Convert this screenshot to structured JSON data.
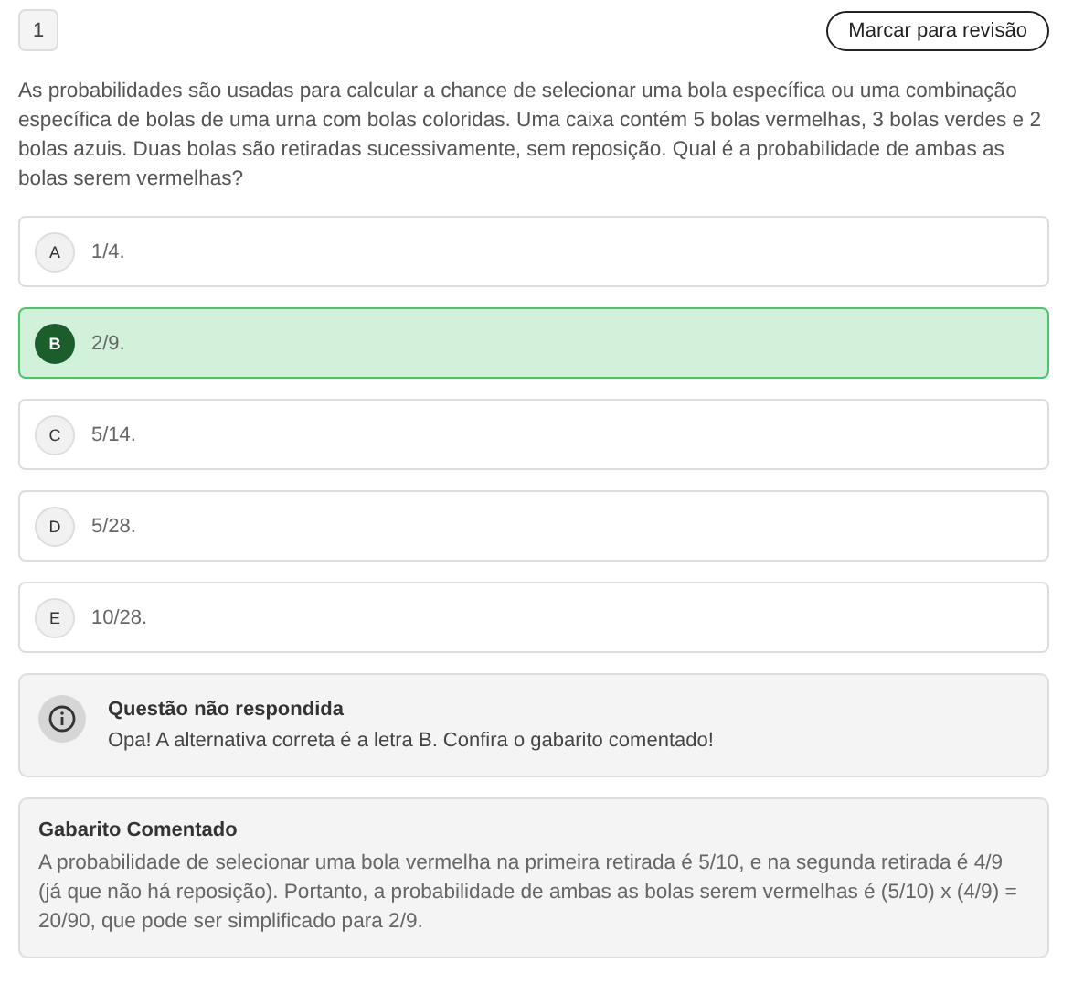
{
  "question_number": "1",
  "review_button": "Marcar para revisão",
  "question": "As probabilidades são usadas para calcular a chance de selecionar uma bola específica ou uma combinação específica de bolas de uma urna com bolas coloridas. Uma caixa contém 5 bolas vermelhas, 3 bolas verdes e 2 bolas azuis. Duas bolas são retiradas sucessivamente, sem reposição. Qual é a probabilidade de ambas as bolas serem vermelhas?",
  "options": [
    {
      "letter": "A",
      "text": "1/4.",
      "selected": false
    },
    {
      "letter": "B",
      "text": "2/9.",
      "selected": true
    },
    {
      "letter": "C",
      "text": "5/14.",
      "selected": false
    },
    {
      "letter": "D",
      "text": "5/28.",
      "selected": false
    },
    {
      "letter": "E",
      "text": "10/28.",
      "selected": false
    }
  ],
  "notice": {
    "title": "Questão não respondida",
    "message": "Opa! A alternativa correta é a letra B. Confira o gabarito comentado!"
  },
  "answer_key": {
    "title": "Gabarito Comentado",
    "text": "A probabilidade de selecionar uma bola vermelha na primeira retirada é 5/10, e na segunda retirada é 4/9 (já que não há reposição). Portanto, a probabilidade de ambas as bolas serem vermelhas é (5/10) x (4/9) = 20/90, que pode ser simplificado para 2/9."
  }
}
